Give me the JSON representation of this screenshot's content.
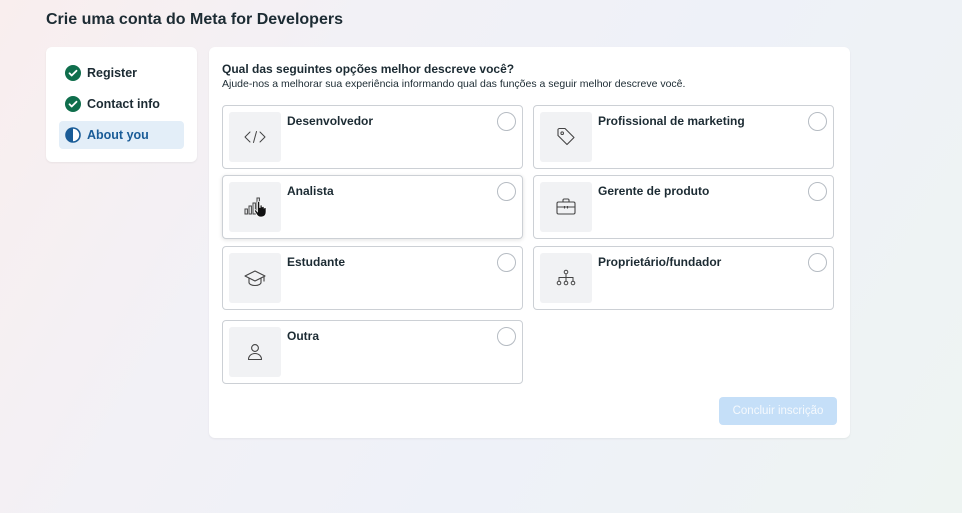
{
  "page": {
    "title": "Crie uma conta do Meta for Developers"
  },
  "stepper": {
    "steps": [
      {
        "label": "Register",
        "state": "done"
      },
      {
        "label": "Contact info",
        "state": "done"
      },
      {
        "label": "About you",
        "state": "current"
      }
    ]
  },
  "form": {
    "question": "Qual das seguintes opções melhor descreve você?",
    "helper": "Ajude-nos a melhorar sua experiência informando qual das funções a seguir melhor descreve você.",
    "options": [
      {
        "label": "Desenvolvedor",
        "icon": "code-icon"
      },
      {
        "label": "Profissional de marketing",
        "icon": "tag-icon"
      },
      {
        "label": "Analista",
        "icon": "bar-chart-icon"
      },
      {
        "label": "Gerente de produto",
        "icon": "briefcase-icon"
      },
      {
        "label": "Estudante",
        "icon": "graduation-cap-icon"
      },
      {
        "label": "Proprietário/fundador",
        "icon": "org-chart-icon"
      },
      {
        "label": "Outra",
        "icon": "person-icon"
      }
    ],
    "submit_label": "Concluir inscrição"
  },
  "colors": {
    "accent": "#1b74e4",
    "check": "#0f6e4c",
    "submit_disabled": "#c5dff8"
  }
}
